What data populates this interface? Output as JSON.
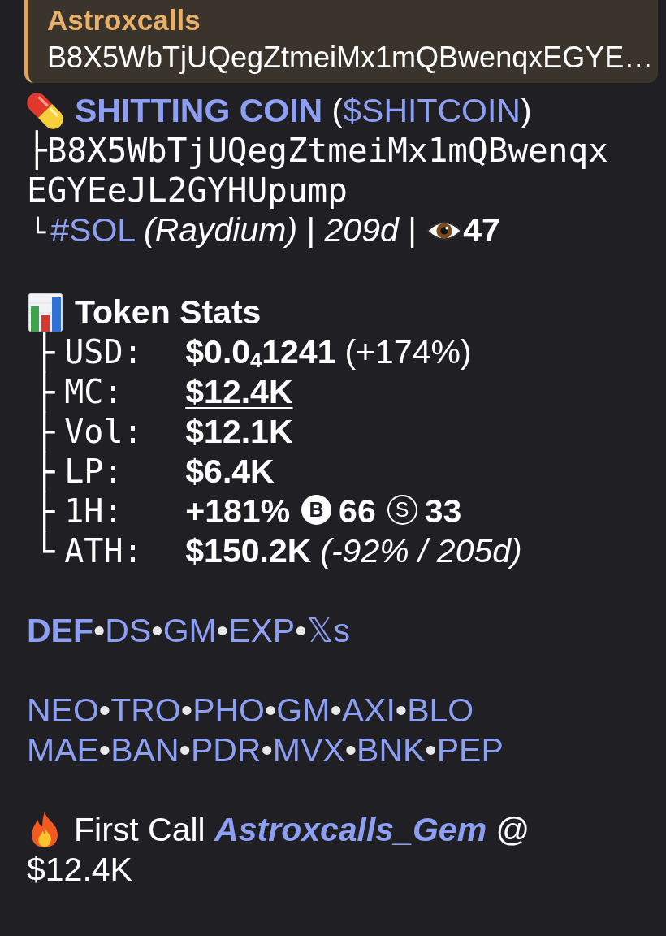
{
  "reply_quote": {
    "author": "Astroxcalls",
    "text": "B8X5WbTjUQegZtmeiMx1mQBwenqxEGYE…"
  },
  "token": {
    "name": "SHITTING COIN",
    "open": "(",
    "ticker": "$SHITCOIN",
    "close": ")"
  },
  "contract": {
    "branch": "├",
    "address": "B8X5WbTjUQegZtmeiMx1mQBwenqxEGYEeJL2GYHUpump"
  },
  "meta": {
    "branch": "└",
    "chain": "#SOL",
    "dex": "(Raydium)",
    "sep_1": "|",
    "age": "209d",
    "sep_2": "|",
    "views": "47"
  },
  "stats": {
    "title": "Token Stats",
    "rows": [
      {
        "branch": "├",
        "label": "USD:",
        "value": "$0.0$_{4}$1241",
        "note": "(+174%)",
        "note_italic": false,
        "underline": false
      },
      {
        "branch": "├",
        "label": "MC:",
        "value": "$12.4K",
        "underline": true
      },
      {
        "branch": "├",
        "label": "Vol:",
        "value": "$12.1K",
        "underline": false
      },
      {
        "branch": "├",
        "label": "LP:",
        "value": "$6.4K",
        "underline": false
      },
      {
        "branch": "├",
        "label": "1H:",
        "value": "+181%",
        "underline": false,
        "markers": [
          {
            "kind": "filled",
            "letter": "B",
            "count": "66"
          },
          {
            "kind": "outline",
            "letter": "S",
            "count": "33"
          }
        ]
      },
      {
        "branch": "└",
        "label": "ATH:",
        "value": "$150.2K",
        "note": "(-92% / 205d)",
        "note_italic": true,
        "underline": false
      }
    ]
  },
  "quick_links": [
    {
      "text": "DEF",
      "bold": true
    },
    {
      "sep": "•",
      "text": "DS",
      "bold": false
    },
    {
      "sep": "•",
      "text": "GM",
      "bold": false
    },
    {
      "sep": "•",
      "text": "EXP",
      "bold": false
    },
    {
      "sep": "•",
      "text": "𝕏s",
      "bold": false
    }
  ],
  "platform_links": [
    [
      {
        "text": "NEO"
      },
      {
        "sep": "•",
        "text": "TRO"
      },
      {
        "sep": "•",
        "text": "PHO"
      },
      {
        "sep": "•",
        "text": "GM"
      },
      {
        "sep": "•",
        "text": "AXI"
      },
      {
        "sep": "•",
        "text": "BLO"
      }
    ],
    [
      {
        "text": "MAE"
      },
      {
        "sep": "•",
        "text": "BAN"
      },
      {
        "sep": "•",
        "text": "PDR"
      },
      {
        "sep": "•",
        "text": "MVX"
      },
      {
        "sep": "•",
        "text": "BNK"
      },
      {
        "sep": "•",
        "text": "PEP"
      }
    ]
  ],
  "first_call": {
    "label": "First Call",
    "caller": "Astroxcalls_Gem",
    "at": "@",
    "market_cap": "$12.4K"
  }
}
